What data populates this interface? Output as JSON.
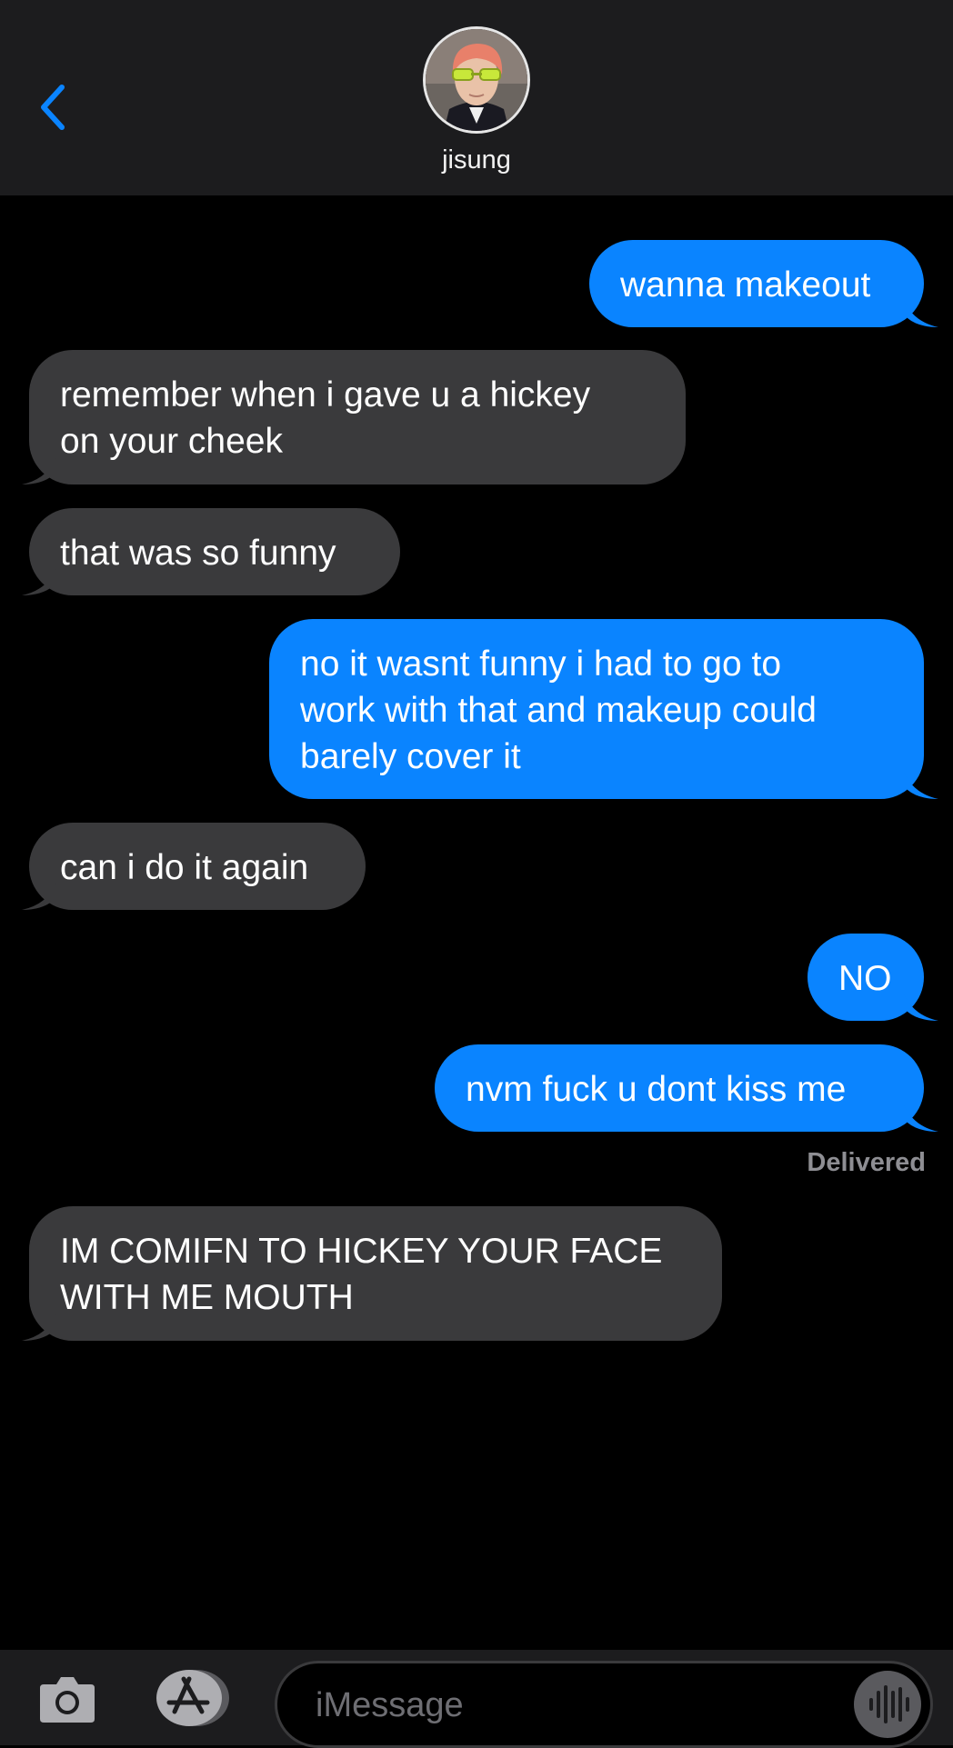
{
  "header": {
    "contact_name": "jisung",
    "back_icon": "chevron-left-icon",
    "accent_color": "#0a84ff"
  },
  "messages": [
    {
      "direction": "out",
      "text": "wanna makeout"
    },
    {
      "direction": "in",
      "lines": [
        "remember when i gave u a hickey",
        "on your cheek"
      ]
    },
    {
      "direction": "in",
      "text": "that was so funny"
    },
    {
      "direction": "out",
      "lines": [
        "no it wasnt funny i had to go to",
        "work with that and makeup could",
        "barely cover it"
      ]
    },
    {
      "direction": "in",
      "text": "can i do it again"
    },
    {
      "direction": "out",
      "text": "NO"
    },
    {
      "direction": "out",
      "text": "nvm fuck u dont kiss me"
    },
    {
      "direction": "in",
      "lines": [
        "IM COMIFN TO HICKEY YOUR FACE",
        "WITH ME MOUTH"
      ]
    }
  ],
  "status": {
    "delivered": "Delivered"
  },
  "composer": {
    "placeholder": "iMessage",
    "camera_icon": "camera-icon",
    "apps_icon": "app-store-icon",
    "audio_icon": "audio-waveform-icon"
  },
  "colors": {
    "incoming_bubble": "#3a3a3c",
    "outgoing_bubble": "#0a84ff",
    "background": "#000000",
    "bar": "#1c1c1e"
  }
}
